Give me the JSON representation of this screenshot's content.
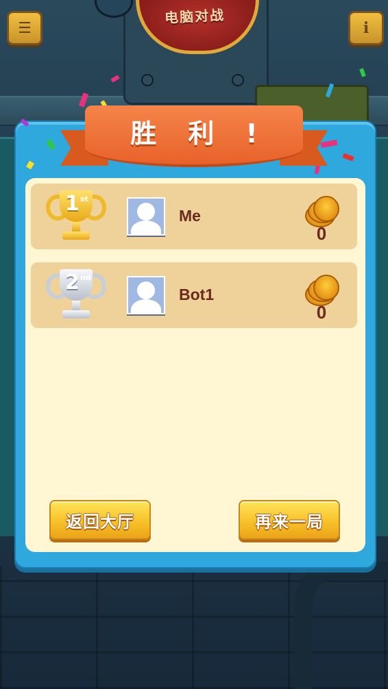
{
  "header": {
    "mode_banner": "电脑对战",
    "menu_icon": "menu-icon",
    "info_icon": "info-icon",
    "info_glyph": "i"
  },
  "dialog": {
    "title": "胜利!"
  },
  "results": [
    {
      "rank_number": "1",
      "rank_suffix": "st",
      "trophy": "gold-trophy-icon",
      "name": "Me",
      "coins": "0"
    },
    {
      "rank_number": "2",
      "rank_suffix": "nd",
      "trophy": "silver-trophy-icon",
      "name": "Bot1",
      "coins": "0"
    }
  ],
  "buttons": {
    "back_to_lobby": "返回大厅",
    "play_again": "再来一局"
  },
  "colors": {
    "dialog_frame": "#2fa8dd",
    "dialog_body": "#fff6d3",
    "row_background": "#efd29a",
    "ribbon": "#e8622a",
    "button": "#f7c12a",
    "name_text": "#6b2a1f"
  }
}
